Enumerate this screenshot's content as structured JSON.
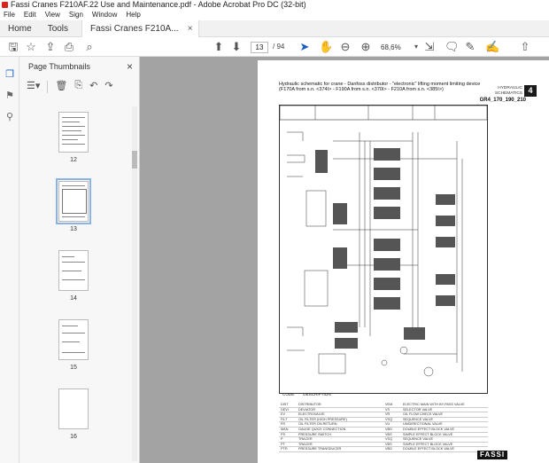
{
  "window": {
    "title": "Fassi Cranes F210AF.22 Use and Maintenance.pdf - Adobe Acrobat Pro DC (32-bit)"
  },
  "menu": [
    "File",
    "Edit",
    "View",
    "Sign",
    "Window",
    "Help"
  ],
  "tabs": {
    "home": "Home",
    "tools": "Tools",
    "doc": "Fassi Cranes F210A...",
    "close": "×"
  },
  "toolbar": {
    "page_current": "13",
    "page_total": "/ 94",
    "zoom": "68,6%"
  },
  "thumbnails_panel": {
    "header": "Page Thumbnails",
    "close": "×",
    "pages": [
      {
        "num": "12",
        "selected": false
      },
      {
        "num": "13",
        "selected": true
      },
      {
        "num": "14",
        "selected": false
      },
      {
        "num": "15",
        "selected": false
      },
      {
        "num": "16",
        "selected": false
      }
    ]
  },
  "document": {
    "title_line1": "Hydraulic schematic for crane - Danfoss distributor - \"electronic\" lifting moment limiting device",
    "title_line2": "(F170A from s.n. <374I> - F190A from s.n. <370I> - F210A from s.n. <385I>)",
    "section_label_1": "HYDRAULIC",
    "section_label_2": "SCHEMATICS",
    "chapter": "4",
    "code": "GR4_170_190_210",
    "brand": "FASSI",
    "legend_headers": {
      "code": "CODE",
      "description": "DESCRIPTION"
    },
    "legend_left": [
      [
        "DIST",
        "DISTRIBUTOR"
      ],
      [
        "DEVI",
        "DEVIATOR"
      ],
      [
        "EV",
        "ELECTROVALVE"
      ],
      [
        "FILT",
        "OIL FILTER (HIGH PRESSURE)"
      ],
      [
        "FR",
        "OIL FILTER ON RETURN"
      ],
      [
        "MAN",
        "GAUGE QUICK CONNECTION"
      ],
      [
        "PS",
        "PRESSURE SWITCH"
      ],
      [
        "P",
        "TRACER"
      ],
      [
        "PT",
        "TRACER"
      ],
      [
        "PTR",
        "PRESSURE TRANSDUCER"
      ]
    ],
    "legend_right": [
      [
        "VEM",
        "ELECTRIC MAIN WITH BY-PASS VALVE"
      ],
      [
        "VS",
        "SELECTOR VALVE"
      ],
      [
        "VR",
        "OIL FLOW CHECK VALVE"
      ],
      [
        "VSQ",
        "SEQUENCE VALVE"
      ],
      [
        "VU",
        "UNIDIRECTIONAL VALVE"
      ],
      [
        "VBD",
        "DOUBLE EFFECT BLOCK VALVE"
      ],
      [
        "VBS",
        "SIMPLE EFFECT BLOCK VALVE"
      ],
      [
        "VSQ",
        "SEQUENCE VALVE"
      ],
      [
        "VBS",
        "SIMPLE EFFECT BLOCK VALVE"
      ],
      [
        "VBD",
        "DOUBLE EFFECT BLOCK VALVE"
      ]
    ]
  },
  "colors": {
    "canvas_bg": "#a3a3a3",
    "accent": "#8ab4e8"
  },
  "icons": {
    "toolbar": [
      "save-icon",
      "bookmark-star-icon",
      "upload-icon",
      "print-icon",
      "search-icon",
      "page-up-icon",
      "page-down-icon",
      "select-cursor-icon",
      "hand-icon",
      "zoom-out-icon",
      "zoom-in-icon",
      "fit-page-icon",
      "comment-icon",
      "highlighter-icon",
      "sign-icon",
      "share-icon"
    ],
    "rail": [
      "copy-pages-icon",
      "bookmark-icon",
      "attachment-icon"
    ],
    "thumbs_tools": [
      "options-icon",
      "delete-icon",
      "extract-icon",
      "rotate-left-icon",
      "rotate-right-icon"
    ]
  }
}
